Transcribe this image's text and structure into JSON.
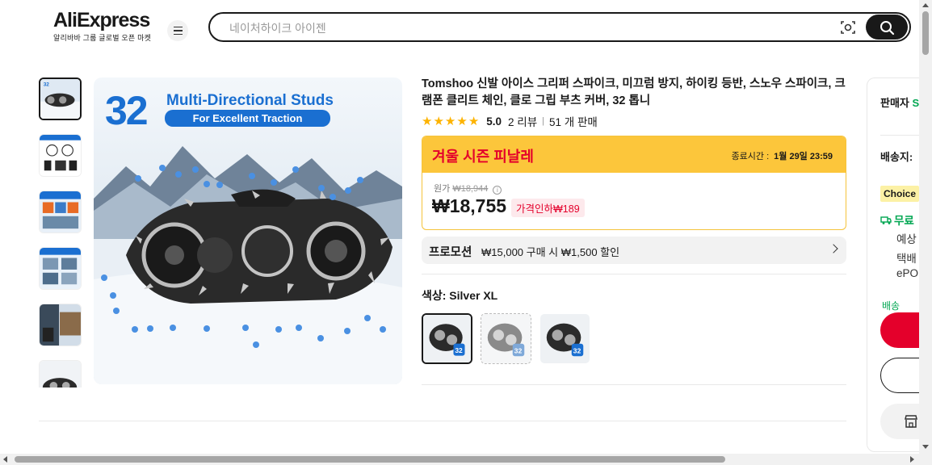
{
  "header": {
    "logo_text": "AliExpress",
    "logo_subtitle": "알리바바 그룹 글로벌 오픈 마켓",
    "search_placeholder": "네이처하이크 아이젠"
  },
  "gallery": {
    "thumbnail_count": 6,
    "main_image_text": {
      "number": "32",
      "title": "Multi-Directional Studs",
      "subtitle": "For Excellent Traction"
    }
  },
  "product": {
    "title": "Tomshoo 신발 아이스 그리퍼 스파이크, 미끄럼 방지, 하이킹 등반, 스노우 스파이크, 크램폰 클리트 체인, 클로 그립 부츠 커버, 32 톱니",
    "rating": {
      "stars": 5,
      "score": "5.0",
      "reviews": "2 리뷰",
      "sold": "51 개 판매"
    },
    "sale": {
      "title": "겨울 시즌 피날레",
      "end_label": "종료시간 :",
      "end_time": "1월 29일 23:59"
    },
    "price": {
      "original_label": "원가",
      "original_price": "₩18,944",
      "info_icon": "i",
      "current_price": "₩18,755",
      "discount_label": "가격인하₩189"
    },
    "promotion": {
      "title": "프로모션",
      "text": "₩15,000 구매 시 ₩1,500 할인"
    },
    "color": {
      "label": "색상: Silver XL",
      "variants": [
        {
          "badge": "32",
          "state": "selected"
        },
        {
          "badge": "32",
          "state": "unavailable"
        },
        {
          "badge": "32",
          "state": "available"
        }
      ]
    }
  },
  "side_panel": {
    "seller_label": "판매자",
    "seller_name_partial": "S",
    "shipping_label": "배송지:",
    "choice_badge": "Choice",
    "free_shipping": "무료",
    "line1": "예상",
    "line2": "택배",
    "line3": "ePO",
    "green_note": "배송"
  },
  "colors": {
    "accent_red": "#e4002b",
    "sale_yellow": "#fcc63b",
    "rating_star": "#fdb300",
    "brand_blue": "#1a6fd1",
    "choice_yellow": "#fcf1a5",
    "free_green": "#00a651"
  },
  "icons": {
    "menu": "hamburger-icon",
    "camera": "camera-search-icon",
    "search": "search-icon",
    "chevron": "chevron-right-icon",
    "truck": "truck-icon",
    "store": "store-icon"
  }
}
